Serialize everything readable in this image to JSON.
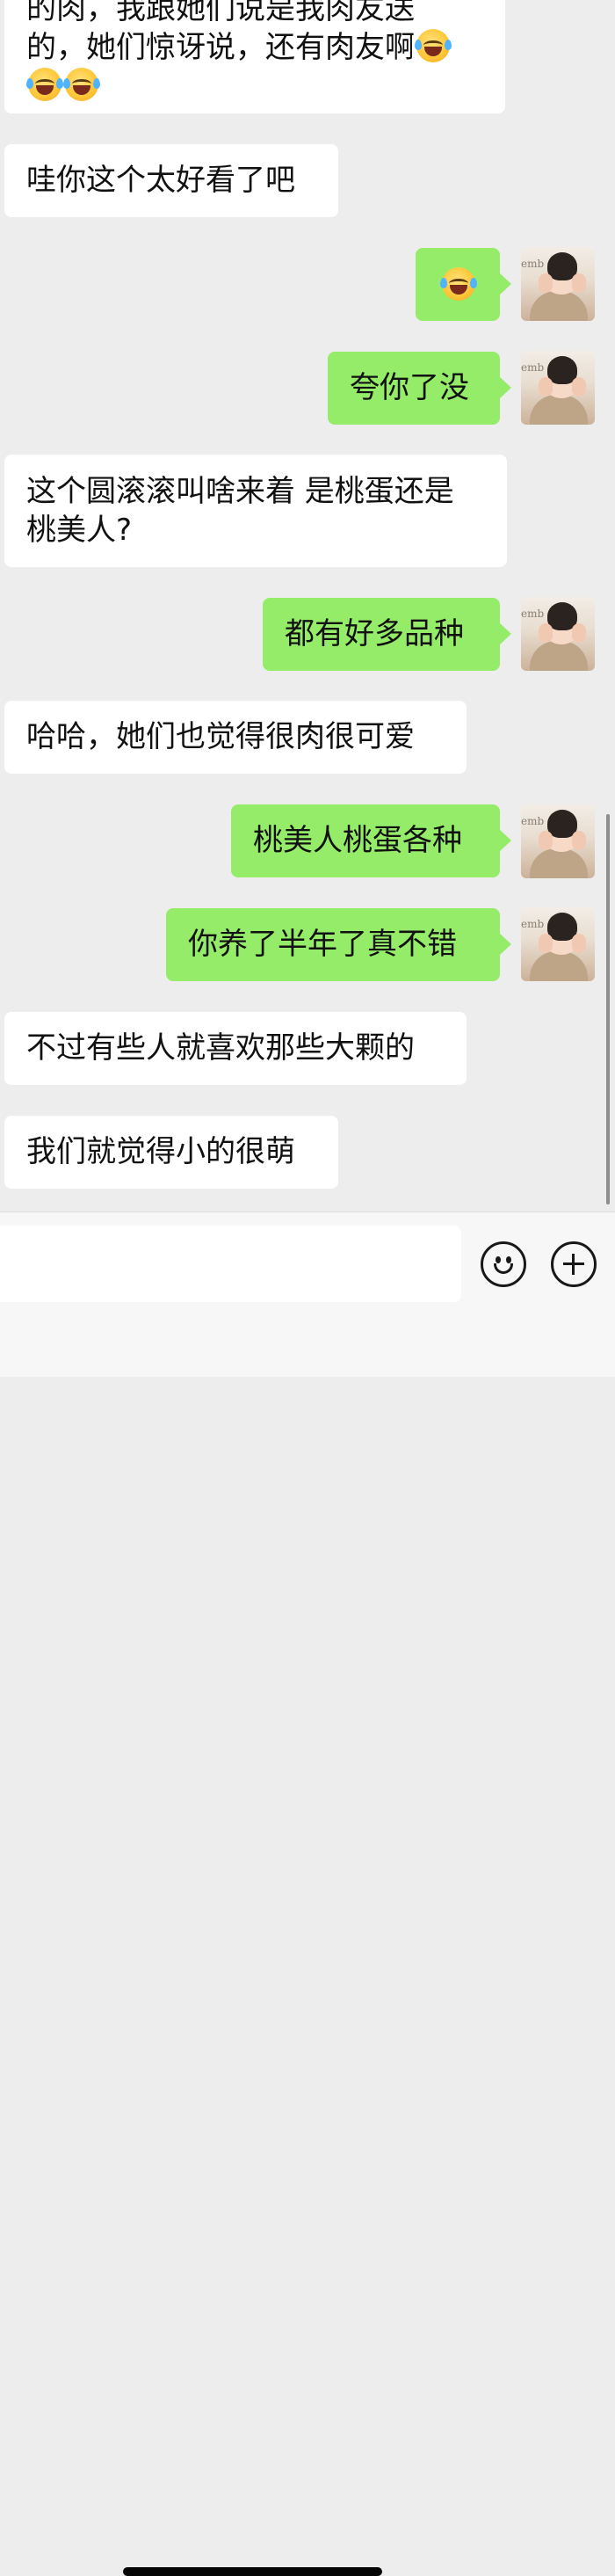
{
  "messages": [
    {
      "id": "m1",
      "side": "left",
      "lines": [
        "的肉，我跟她们说是我肉友送",
        "的，她们惊讶说，还有肉友啊"
      ],
      "emoji_after": 3
    },
    {
      "id": "m2",
      "side": "left",
      "text": "哇你这个太好看了吧"
    },
    {
      "id": "m3",
      "side": "right",
      "emoji_only": true
    },
    {
      "id": "m4",
      "side": "right",
      "text": "夸你了没"
    },
    {
      "id": "m5",
      "side": "left",
      "lines": [
        "这个圆滚滚叫啥来着 是桃蛋还是",
        "桃美人?"
      ]
    },
    {
      "id": "m6",
      "side": "right",
      "text": "都有好多品种"
    },
    {
      "id": "m7",
      "side": "left",
      "text": "哈哈，她们也觉得很肉很可爱"
    },
    {
      "id": "m8",
      "side": "right",
      "text": "桃美人桃蛋各种"
    },
    {
      "id": "m9",
      "side": "right",
      "text": "你养了半年了真不错"
    },
    {
      "id": "m10",
      "side": "left",
      "text": "不过有些人就喜欢那些大颗的"
    },
    {
      "id": "m11",
      "side": "left",
      "text": "我们就觉得小的很萌"
    }
  ],
  "avatar_mark": "emb",
  "input": {
    "value": "",
    "placeholder": ""
  },
  "icons": {
    "emoji_button": "smiley-face-icon",
    "plus_button": "plus-circle-icon",
    "laughing_emoji": "face-with-tears-of-joy"
  },
  "colors": {
    "background": "#ededed",
    "bubble_right": "#95ec69",
    "bubble_left": "#ffffff",
    "input_bar": "#f7f7f7"
  }
}
